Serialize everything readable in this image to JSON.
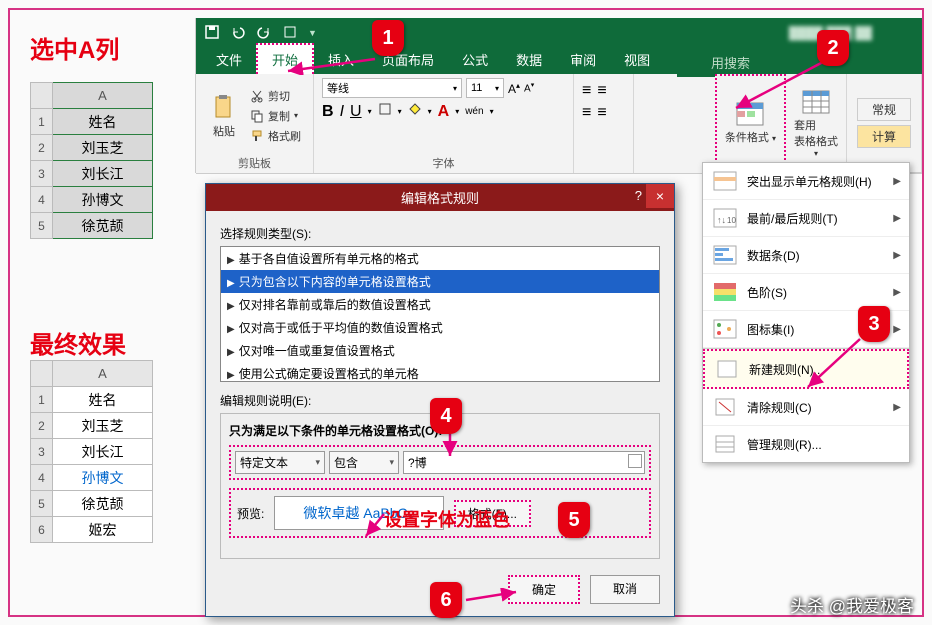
{
  "headings": {
    "select_col": "选中A列",
    "final_result": "最终效果"
  },
  "table1": {
    "col": "A",
    "rows": [
      "姓名",
      "刘玉芝",
      "刘长江",
      "孙博文",
      "徐苋颉"
    ]
  },
  "table2": {
    "col": "A",
    "rows": [
      "姓名",
      "刘玉芝",
      "刘长江",
      "孙博文",
      "徐苋颉",
      "姬宏"
    ]
  },
  "ribbon": {
    "qat_save": "保存",
    "qat_undo": "撤销",
    "tabs": {
      "file": "文件",
      "home": "开始",
      "insert": "插入",
      "layout": "页面布局",
      "formula": "公式",
      "data": "数据",
      "review": "审阅",
      "view": "视图"
    },
    "search": "用搜索",
    "clipboard": {
      "paste": "粘贴",
      "cut": "剪切",
      "copy": "复制",
      "brush": "格式刷",
      "title": "剪贴板"
    },
    "font": {
      "name": "等线",
      "size": "11",
      "title": "字体",
      "bold": "B",
      "italic": "I",
      "underline": "U",
      "wen": "wén"
    },
    "cond_fmt": "条件格式",
    "table_fmt": "套用\n表格格式",
    "general": "常规",
    "calc": "计算"
  },
  "cf_menu": {
    "highlight": "突出显示单元格规则(H)",
    "topbottom": "最前/最后规则(T)",
    "databar": "数据条(D)",
    "colorscale": "色阶(S)",
    "iconset": "图标集(I)",
    "newrule": "新建规则(N)...",
    "clear": "清除规则(C)",
    "manage": "管理规则(R)..."
  },
  "dialog": {
    "title": "编辑格式规则",
    "type_label": "选择规则类型(S):",
    "rules": [
      "基于各自值设置所有单元格的格式",
      "只为包含以下内容的单元格设置格式",
      "仅对排名靠前或靠后的数值设置格式",
      "仅对高于或低于平均值的数值设置格式",
      "仅对唯一值或重复值设置格式",
      "使用公式确定要设置格式的单元格"
    ],
    "rule_selected": 1,
    "desc_label": "编辑规则说明(E):",
    "cond_label": "只为满足以下条件的单元格设置格式(O):",
    "combo1": "特定文本",
    "combo2": "包含",
    "value": "?博",
    "preview_label": "预览:",
    "preview_text": "微软卓越 AaBbCc",
    "format_btn": "格式(F)...",
    "ok": "确定",
    "cancel": "取消"
  },
  "annotations": {
    "set_font_blue": "设置字体为蓝色",
    "b1": "1",
    "b2": "2",
    "b3": "3",
    "b4": "4",
    "b5": "5",
    "b6": "6"
  },
  "watermark": "头杀 @我爱极客"
}
